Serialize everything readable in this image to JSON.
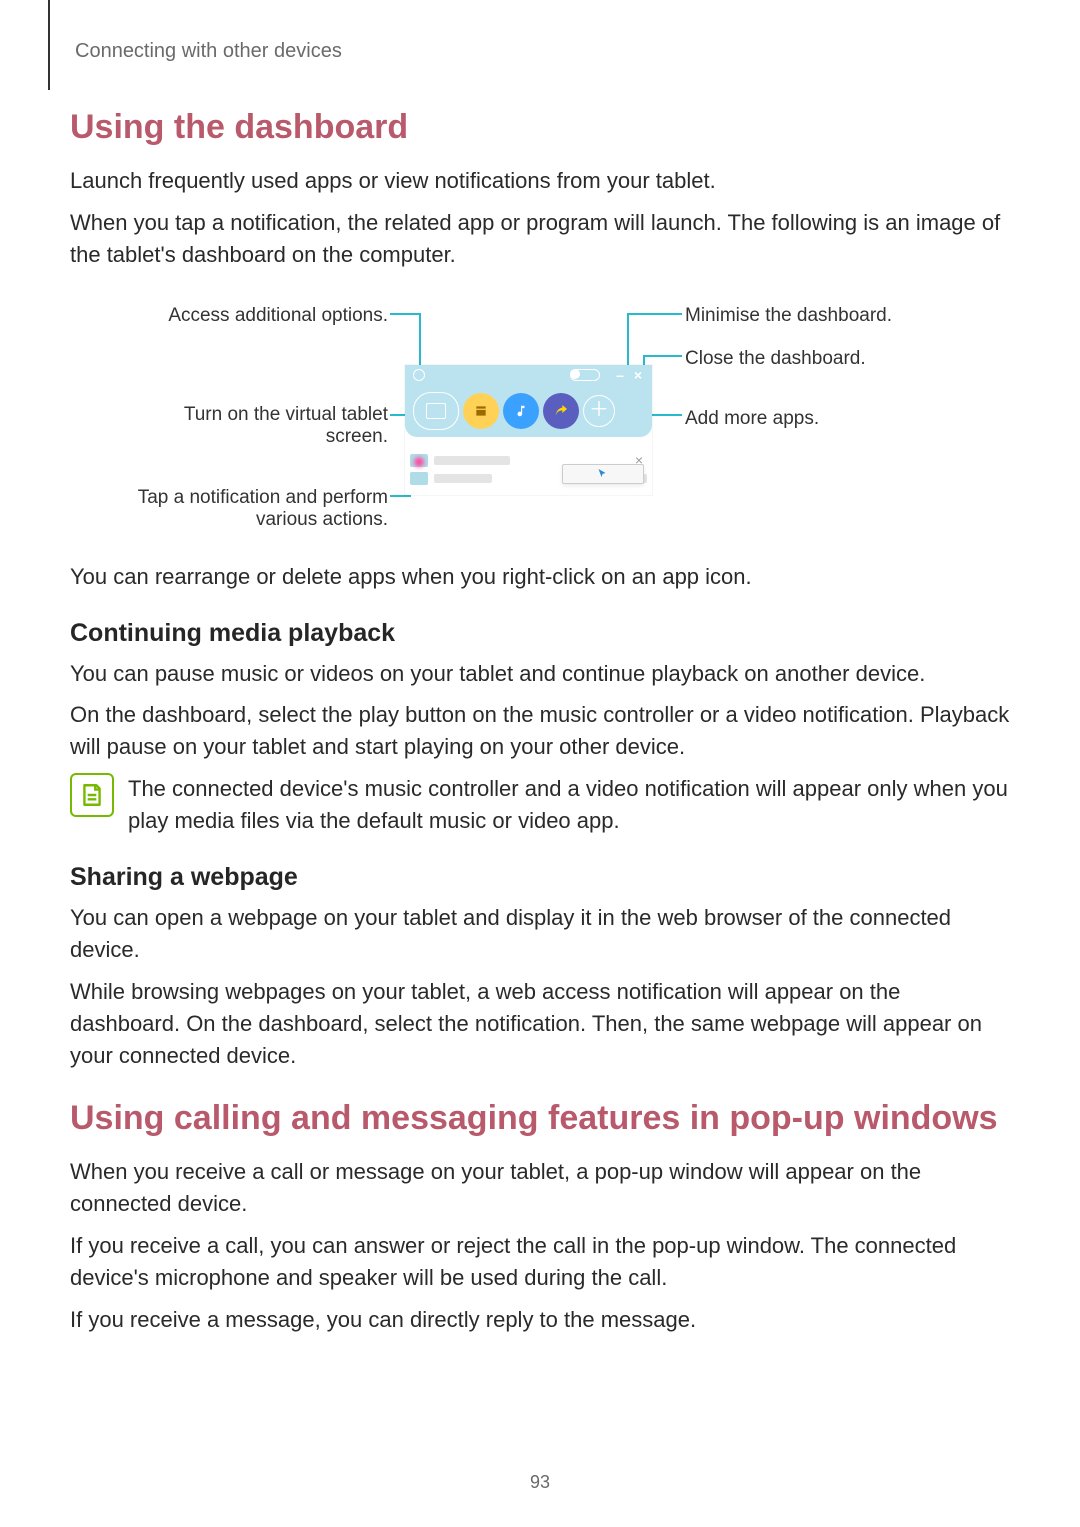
{
  "breadcrumb": "Connecting with other devices",
  "section1": {
    "title": "Using the dashboard",
    "p1": "Launch frequently used apps or view notifications from your tablet.",
    "p2": "When you tap a notification, the related app or program will launch. The following is an image of the tablet's dashboard on the computer.",
    "callouts": {
      "left1": "Access additional options.",
      "left2": "Turn on the virtual tablet\nscreen.",
      "left3": "Tap a notification and perform\nvarious actions.",
      "right1": "Minimise the dashboard.",
      "right2": "Close the dashboard.",
      "right3": "Add more apps."
    },
    "p3": "You can rearrange or delete apps when you right-click on an app icon."
  },
  "section2": {
    "title": "Continuing media playback",
    "p1": "You can pause music or videos on your tablet and continue playback on another device.",
    "p2": "On the dashboard, select the play button on the music controller or a video notification. Playback will pause on your tablet and start playing on your other device.",
    "note": "The connected device's music controller and a video notification will appear only when you play media files via the default music or video app."
  },
  "section3": {
    "title": "Sharing a webpage",
    "p1": "You can open a webpage on your tablet and display it in the web browser of the connected device.",
    "p2": "While browsing webpages on your tablet, a web access notification will appear on the dashboard. On the dashboard, select the notification. Then, the same webpage will appear on your connected device."
  },
  "section4": {
    "title": "Using calling and messaging features in pop-up windows",
    "p1": "When you receive a call or message on your tablet, a pop-up window will appear on the connected device.",
    "p2": "If you receive a call, you can answer or reject the call in the pop-up window. The connected device's microphone and speaker will be used during the call.",
    "p3": "If you receive a message, you can directly reply to the message."
  },
  "pageNumber": "93",
  "colors": {
    "heading": "#b95a6c",
    "leader": "#28b9cc",
    "noteGreen": "#76b900"
  },
  "dashboard_ui": {
    "minimise_glyph": "–",
    "close_glyph": "×",
    "add_glyph": "＋",
    "notif_close_glyph": "×"
  }
}
